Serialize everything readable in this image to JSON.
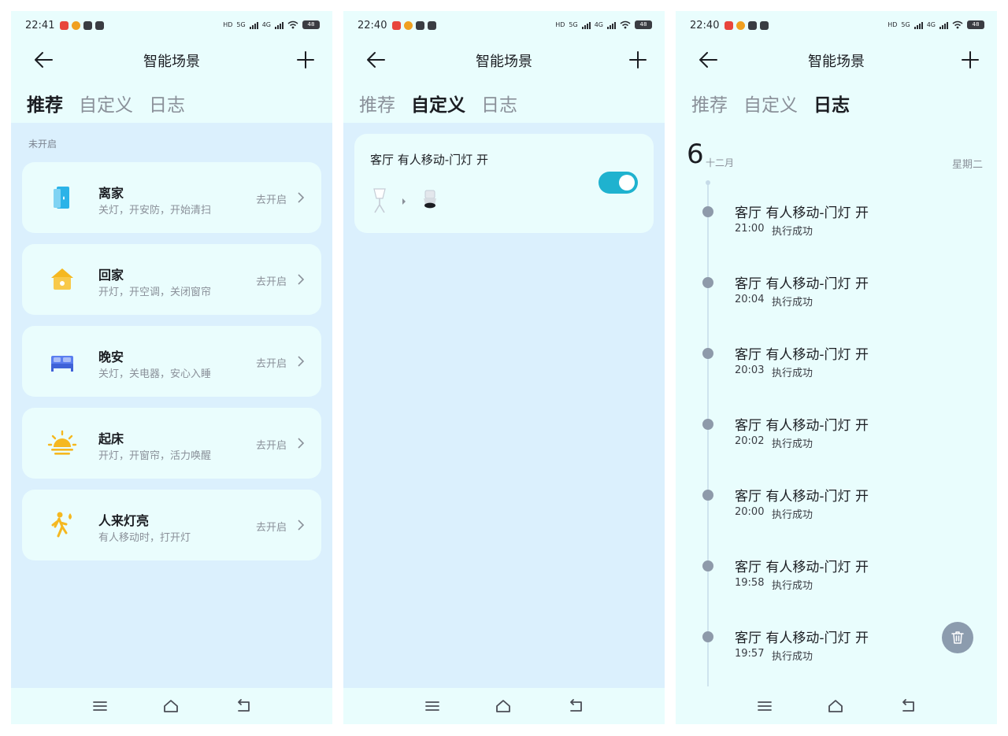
{
  "screens": [
    {
      "status": {
        "time": "22:41",
        "battery": "48",
        "hd": "HD",
        "net1": "5G",
        "net2": "4G"
      },
      "title": "智能场景",
      "tabs": [
        {
          "label": "推荐",
          "active": true
        },
        {
          "label": "自定义",
          "active": false
        },
        {
          "label": "日志",
          "active": false
        }
      ],
      "section_label": "未开启",
      "scenes": [
        {
          "name": "离家",
          "desc": "关灯，开安防，开始清扫",
          "action": "去开启",
          "icon": "door-exit-icon",
          "color": "#2bb3e8"
        },
        {
          "name": "回家",
          "desc": "开灯，开空调，关闭窗帘",
          "action": "去开启",
          "icon": "house-icon",
          "color": "#f5b820"
        },
        {
          "name": "晚安",
          "desc": "关灯，关电器，安心入睡",
          "action": "去开启",
          "icon": "bed-icon",
          "color": "#5b7ef0"
        },
        {
          "name": "起床",
          "desc": "开灯，开窗帘，活力唤醒",
          "action": "去开启",
          "icon": "sunrise-icon",
          "color": "#f5b820"
        },
        {
          "name": "人来灯亮",
          "desc": "有人移动时，打开灯",
          "action": "去开启",
          "icon": "person-walking-icon",
          "color": "#f5b820"
        }
      ]
    },
    {
      "status": {
        "time": "22:40",
        "battery": "48",
        "hd": "HD",
        "net1": "5G",
        "net2": "4G"
      },
      "title": "智能场景",
      "tabs": [
        {
          "label": "推荐",
          "active": false
        },
        {
          "label": "自定义",
          "active": true
        },
        {
          "label": "日志",
          "active": false
        }
      ],
      "automation": {
        "title": "客厅 有人移动-门灯 开",
        "enabled": true,
        "trigger_icon": "motion-sensor-icon",
        "target_icon": "downlight-icon"
      }
    },
    {
      "status": {
        "time": "22:40",
        "battery": "48",
        "hd": "HD",
        "net1": "5G",
        "net2": "4G"
      },
      "title": "智能场景",
      "tabs": [
        {
          "label": "推荐",
          "active": false
        },
        {
          "label": "自定义",
          "active": false
        },
        {
          "label": "日志",
          "active": true
        }
      ],
      "log": {
        "day": "6",
        "month": "十二月",
        "weekday": "星期二",
        "entries": [
          {
            "title": "客厅 有人移动-门灯 开",
            "time": "21:00",
            "status": "执行成功"
          },
          {
            "title": "客厅 有人移动-门灯 开",
            "time": "20:04",
            "status": "执行成功"
          },
          {
            "title": "客厅 有人移动-门灯 开",
            "time": "20:03",
            "status": "执行成功"
          },
          {
            "title": "客厅 有人移动-门灯 开",
            "time": "20:02",
            "status": "执行成功"
          },
          {
            "title": "客厅 有人移动-门灯 开",
            "time": "20:00",
            "status": "执行成功"
          },
          {
            "title": "客厅 有人移动-门灯 开",
            "time": "19:58",
            "status": "执行成功"
          },
          {
            "title": "客厅 有人移动-门灯 开",
            "time": "19:57",
            "status": "执行成功"
          }
        ]
      }
    }
  ]
}
